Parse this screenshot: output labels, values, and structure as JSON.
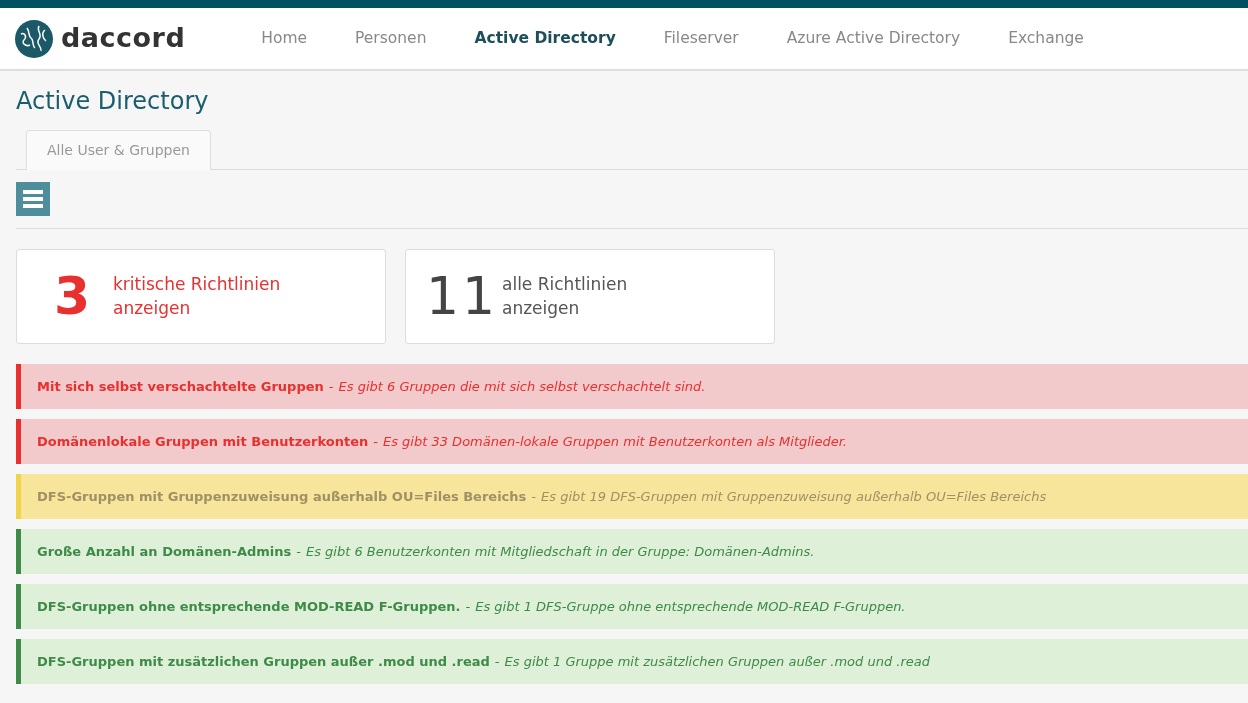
{
  "brand": {
    "name": "daccord"
  },
  "nav": [
    {
      "label": "Home",
      "selected": false
    },
    {
      "label": "Personen",
      "selected": false
    },
    {
      "label": "Active Directory",
      "selected": true
    },
    {
      "label": "Fileserver",
      "selected": false
    },
    {
      "label": "Azure Active Directory",
      "selected": false
    },
    {
      "label": "Exchange",
      "selected": false
    }
  ],
  "page_title": "Active Directory",
  "tabs": [
    {
      "label": "Alle User & Gruppen"
    }
  ],
  "alert_separator": "-",
  "stats": [
    {
      "kind": "critical",
      "count": "3",
      "label": "kritische Richtlinien anzeigen"
    },
    {
      "kind": "all",
      "count": "11",
      "label": "alle Richtlinien anzeigen"
    }
  ],
  "alerts": [
    {
      "kind": "danger",
      "title": "Mit sich selbst verschachtelte Gruppen",
      "description": "Es gibt 6 Gruppen die mit sich selbst verschachtelt sind."
    },
    {
      "kind": "danger",
      "title": "Domänenlokale Gruppen mit Benutzerkonten",
      "description": "Es gibt 33 Domänen-lokale Gruppen mit Benutzerkonten als Mitglieder."
    },
    {
      "kind": "warning",
      "title": "DFS-Gruppen mit Gruppenzuweisung außerhalb OU=Files Bereichs",
      "description": "Es gibt 19 DFS-Gruppen mit Gruppenzuweisung außerhalb OU=Files Bereichs"
    },
    {
      "kind": "success",
      "title": "Große Anzahl an Domänen-Admins",
      "description": "Es gibt 6 Benutzerkonten mit Mitgliedschaft in der Gruppe: Domänen-Admins."
    },
    {
      "kind": "success",
      "title": "DFS-Gruppen ohne entsprechende MOD-READ F-Gruppen.",
      "description": "Es gibt 1 DFS-Gruppe ohne entsprechende MOD-READ F-Gruppen."
    },
    {
      "kind": "success",
      "title": "DFS-Gruppen mit zusätzlichen Gruppen außer .mod und .read",
      "description": "Es gibt 1 Gruppe mit zusätzlichen Gruppen außer .mod und .read"
    }
  ]
}
